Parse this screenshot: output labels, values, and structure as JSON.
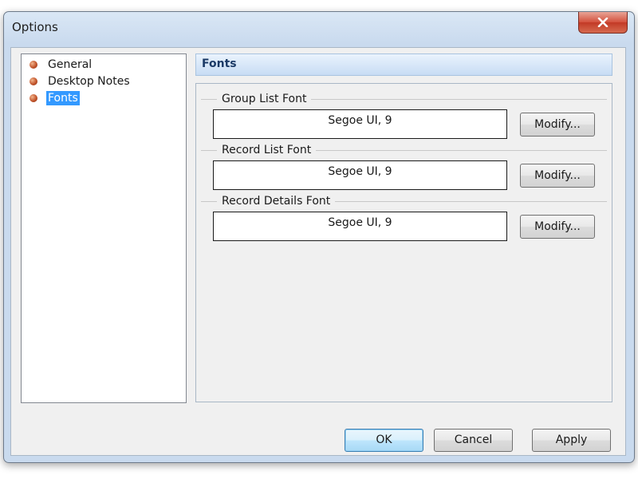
{
  "window": {
    "title": "Options"
  },
  "tree": {
    "items": [
      {
        "label": "General",
        "selected": false
      },
      {
        "label": "Desktop Notes",
        "selected": false
      },
      {
        "label": "Fonts",
        "selected": true
      }
    ]
  },
  "panel": {
    "title": "Fonts",
    "groups": [
      {
        "legend": "Group List Font",
        "value": "Segoe UI, 9",
        "button_label": "Modify..."
      },
      {
        "legend": "Record List Font",
        "value": "Segoe UI, 9",
        "button_label": "Modify..."
      },
      {
        "legend": "Record Details Font",
        "value": "Segoe UI, 9",
        "button_label": "Modify..."
      }
    ]
  },
  "footer": {
    "ok_label": "OK",
    "cancel_label": "Cancel",
    "apply_label": "Apply"
  },
  "colors": {
    "selection": "#3399ff",
    "close_button": "#c23a26",
    "header_text": "#1b3a66"
  },
  "icons": {
    "close": "close-icon",
    "tree_bullet": "bullet-icon"
  }
}
